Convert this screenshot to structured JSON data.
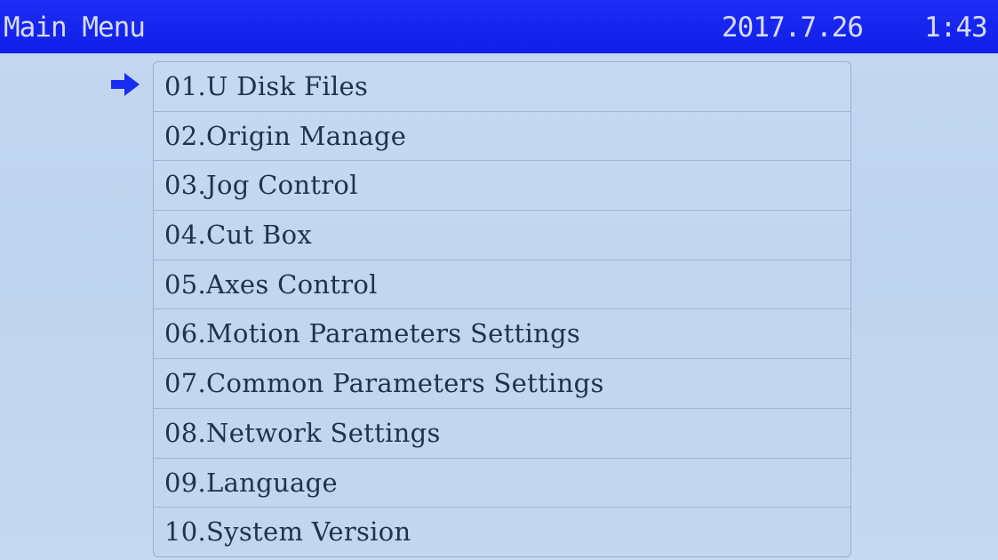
{
  "header": {
    "title": "Main Menu",
    "date": "2017.7.26",
    "time": "1:43"
  },
  "selection_indicator": {
    "icon": "right-arrow-icon",
    "selected_index": 0,
    "color": "#1a2cf2"
  },
  "menu": {
    "items": [
      {
        "label": "01.U Disk Files"
      },
      {
        "label": "02.Origin Manage"
      },
      {
        "label": "03.Jog Control"
      },
      {
        "label": "04.Cut Box"
      },
      {
        "label": "05.Axes Control"
      },
      {
        "label": "06.Motion Parameters Settings"
      },
      {
        "label": "07.Common Parameters Settings"
      },
      {
        "label": "08.Network Settings"
      },
      {
        "label": "09.Language"
      },
      {
        "label": "10.System Version"
      }
    ]
  },
  "colors": {
    "header_background": "#1020e8",
    "header_text": "#d6dcff",
    "screen_background": "#c2d6f0",
    "menu_border": "#98afd2",
    "menu_text": "#22324d"
  }
}
